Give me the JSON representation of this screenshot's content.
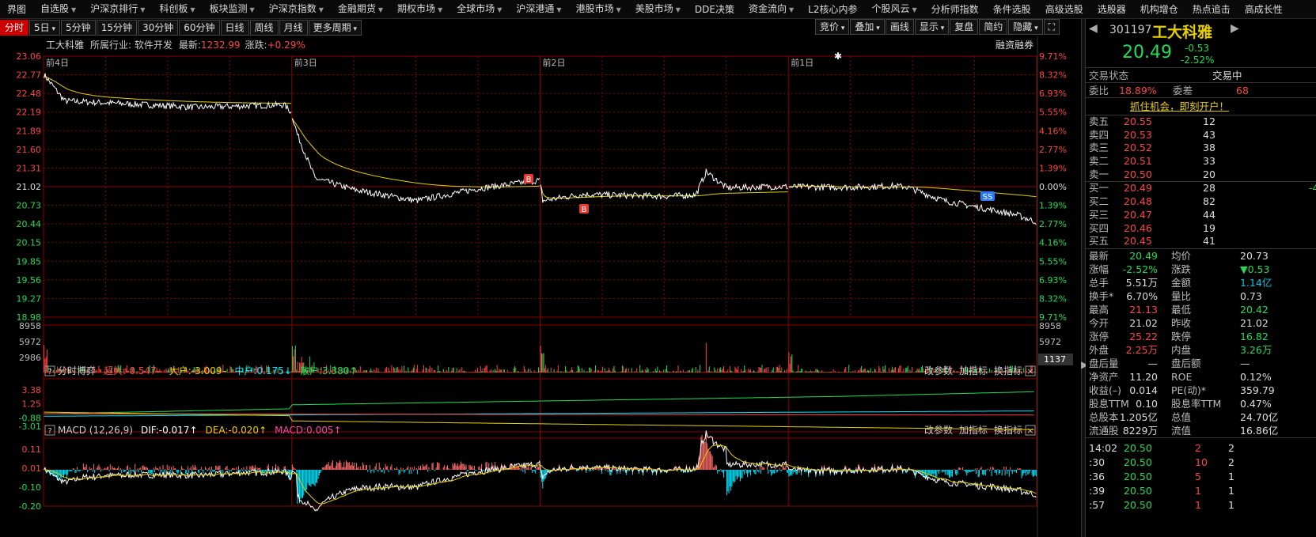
{
  "menu": [
    {
      "label": "界图",
      "dd": false
    },
    {
      "label": "自选股",
      "dd": true
    },
    {
      "label": "沪深京排行",
      "dd": true
    },
    {
      "label": "科创板",
      "dd": true
    },
    {
      "label": "板块监测",
      "dd": true
    },
    {
      "label": "沪深京指数",
      "dd": true
    },
    {
      "label": "金融期货",
      "dd": true
    },
    {
      "label": "期权市场",
      "dd": true
    },
    {
      "label": "全球市场",
      "dd": true
    },
    {
      "label": "沪深港通",
      "dd": true
    },
    {
      "label": "港股市场",
      "dd": true
    },
    {
      "label": "美股市场",
      "dd": true
    },
    {
      "label": "DDE决策",
      "dd": false
    },
    {
      "label": "资金流向",
      "dd": true
    },
    {
      "label": "L2核心内参",
      "dd": false
    },
    {
      "label": "个股风云",
      "dd": true
    },
    {
      "label": "分析师指数",
      "dd": false
    },
    {
      "label": "条件选股",
      "dd": false
    },
    {
      "label": "高级选股",
      "dd": false
    },
    {
      "label": "选股器",
      "dd": false
    },
    {
      "label": "机构增仓",
      "dd": false
    },
    {
      "label": "热点追击",
      "dd": false
    },
    {
      "label": "高成长性",
      "dd": false
    }
  ],
  "periods": [
    "分时",
    "5日",
    "5分钟",
    "15分钟",
    "30分钟",
    "60分钟",
    "日线",
    "周线",
    "月线",
    "更多周期"
  ],
  "periods_dd": [
    false,
    true,
    false,
    false,
    false,
    false,
    false,
    false,
    false,
    true
  ],
  "tools": [
    {
      "label": "竞价",
      "dd": true
    },
    {
      "label": "叠加",
      "dd": true
    },
    {
      "label": "画线",
      "dd": false
    },
    {
      "label": "显示",
      "dd": true
    },
    {
      "label": "复盘",
      "dd": false
    },
    {
      "label": "简约",
      "dd": false
    },
    {
      "label": "隐藏",
      "dd": true
    }
  ],
  "info": {
    "name": "工大科雅",
    "industry": "所属行业: 软件开发",
    "latest_label": "最新:",
    "latest": "1232.99",
    "chg_label": "涨跌:",
    "chg": "+0.29%",
    "margin": "融资融券"
  },
  "day_labels": [
    "前4日",
    "前3日",
    "前2日",
    "前1日"
  ],
  "price_left": [
    "23.06",
    "22.77",
    "22.48",
    "22.19",
    "21.89",
    "21.60",
    "21.31",
    "21.02",
    "20.73",
    "20.44",
    "20.15",
    "19.85",
    "19.56",
    "19.27",
    "18.98"
  ],
  "pct_right": [
    "9.71%",
    "8.32%",
    "6.93%",
    "5.55%",
    "4.16%",
    "2.77%",
    "1.39%",
    "0.00%",
    "1.39%",
    "2.77%",
    "4.16%",
    "5.55%",
    "6.93%",
    "8.32%",
    "9.71%"
  ],
  "vol_labels": [
    "8958",
    "5972",
    "2986"
  ],
  "vol_current": "1137",
  "fund": {
    "title": "分时博弈",
    "items": [
      {
        "label": "超大:",
        "value": "-0.547",
        "arrow": "–"
      },
      {
        "label": "大户:",
        "value": "-3.009",
        "arrow": "–"
      },
      {
        "label": "中户:",
        "value": "0.175",
        "arrow": "↓"
      },
      {
        "label": "散户:",
        "value": "3.380",
        "arrow": "↑"
      }
    ],
    "ylabels": [
      "3.38",
      "1.25",
      "-0.88",
      "-3.01"
    ]
  },
  "macd": {
    "title": "MACD (12,26,9)",
    "items": [
      {
        "label": "DIF:",
        "value": "-0.017",
        "arrow": "↑"
      },
      {
        "label": "DEA:",
        "value": "-0.020",
        "arrow": "↑"
      },
      {
        "label": "MACD:",
        "value": "0.005",
        "arrow": "↑"
      }
    ],
    "ylabels": [
      "0.11",
      "0.01",
      "-0.10",
      "-0.20"
    ]
  },
  "panel_btns": [
    "改参数",
    "加指标",
    "换指标"
  ],
  "markers": {
    "b": "B",
    "s": "SS"
  },
  "stock": {
    "code": "301197",
    "name": "工大科雅",
    "price": "20.49",
    "change": "-0.53",
    "pct": "-2.52%"
  },
  "status": {
    "label": "交易状态",
    "value": "交易中"
  },
  "ratio": {
    "l1": "委比",
    "v1": "18.89%",
    "l2": "委差",
    "v2": "68"
  },
  "banner": "抓住机会，即刻开户！",
  "asks": [
    {
      "label": "卖五",
      "price": "20.55",
      "vol": "12"
    },
    {
      "label": "卖四",
      "price": "20.53",
      "vol": "43"
    },
    {
      "label": "卖三",
      "price": "20.52",
      "vol": "38"
    },
    {
      "label": "卖二",
      "price": "20.51",
      "vol": "33"
    },
    {
      "label": "卖一",
      "price": "20.50",
      "vol": "20"
    }
  ],
  "bids": [
    {
      "label": "买一",
      "price": "20.49",
      "vol": "28",
      "extra": "-4"
    },
    {
      "label": "买二",
      "price": "20.48",
      "vol": "82",
      "extra": ""
    },
    {
      "label": "买三",
      "price": "20.47",
      "vol": "44",
      "extra": ""
    },
    {
      "label": "买四",
      "price": "20.46",
      "vol": "19",
      "extra": ""
    },
    {
      "label": "买五",
      "price": "20.45",
      "vol": "41",
      "extra": ""
    }
  ],
  "quote": [
    {
      "l1": "最新",
      "v1": "20.49",
      "c1": "g",
      "l2": "均价",
      "v2": "20.73",
      "c2": "w"
    },
    {
      "l1": "涨幅",
      "v1": "-2.52%",
      "c1": "g",
      "l2": "涨跌",
      "v2": "▼0.53",
      "c2": "g"
    },
    {
      "l1": "总手",
      "v1": "5.51万",
      "c1": "w",
      "l2": "金额",
      "v2": "1.14亿",
      "c2": "c"
    },
    {
      "l1": "换手*",
      "v1": "6.70%",
      "c1": "w",
      "l2": "量比",
      "v2": "0.73",
      "c2": "w"
    },
    {
      "l1": "最高",
      "v1": "21.13",
      "c1": "r",
      "l2": "最低",
      "v2": "20.42",
      "c2": "g"
    },
    {
      "l1": "今开",
      "v1": "21.02",
      "c1": "w",
      "l2": "昨收",
      "v2": "21.02",
      "c2": "w"
    },
    {
      "l1": "涨停",
      "v1": "25.22",
      "c1": "r",
      "l2": "跌停",
      "v2": "16.82",
      "c2": "g"
    },
    {
      "l1": "外盘",
      "v1": "2.25万",
      "c1": "r",
      "l2": "内盘",
      "v2": "3.26万",
      "c2": "g"
    },
    {
      "l1": "盘后量",
      "v1": "—",
      "c1": "w",
      "l2": "盘后额",
      "v2": "—",
      "c2": "w"
    },
    {
      "l1": "净资产",
      "v1": "11.20",
      "c1": "w",
      "l2": "ROE",
      "v2": "0.12%",
      "c2": "w"
    },
    {
      "l1": "收益(–)",
      "v1": "0.014",
      "c1": "w",
      "l2": "PE(动)*",
      "v2": "359.79",
      "c2": "w"
    },
    {
      "l1": "股息TTM",
      "v1": "0.10",
      "c1": "w",
      "l2": "股息率TTM",
      "v2": "0.47%",
      "c2": "w"
    },
    {
      "l1": "总股本",
      "v1": "1.205亿",
      "c1": "w",
      "l2": "总值",
      "v2": "24.70亿",
      "c2": "w"
    },
    {
      "l1": "流通股",
      "v1": "8229万",
      "c1": "w",
      "l2": "流值",
      "v2": "16.86亿",
      "c2": "w"
    }
  ],
  "ticks": [
    {
      "t": "14:02",
      "p": "20.50",
      "v": "2",
      "e": "2"
    },
    {
      "t": ":30",
      "p": "20.50",
      "v": "10",
      "e": "2"
    },
    {
      "t": ":36",
      "p": "20.50",
      "v": "5",
      "e": "1"
    },
    {
      "t": ":39",
      "p": "20.50",
      "v": "1",
      "e": "1"
    },
    {
      "t": ":57",
      "p": "20.50",
      "v": "1",
      "e": "1"
    }
  ],
  "colors": {
    "up": "#ff4444",
    "down": "#22dd55",
    "avg": "#e8d000",
    "price_line": "#ffffff",
    "grid": "#8b0000",
    "macd_neg": "#00e5ff"
  }
}
